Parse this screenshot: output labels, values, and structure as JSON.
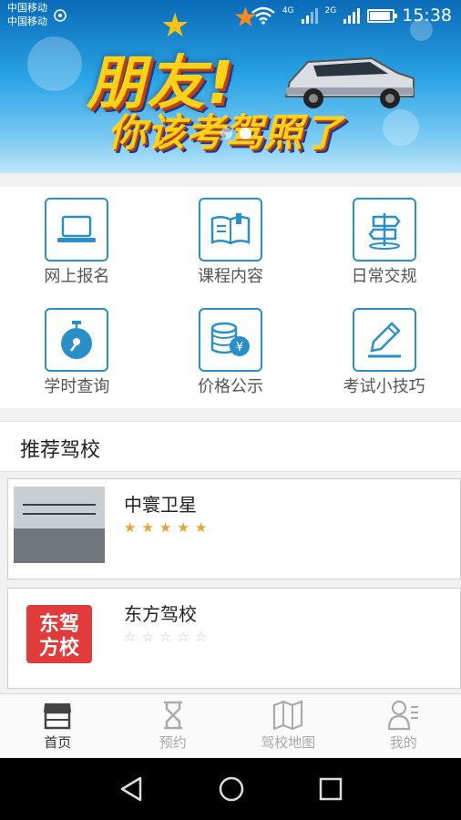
{
  "status_bar": {
    "carrier_1": "中国移动",
    "carrier_2": "中国移动",
    "net_1": "4G",
    "net_2": "2G",
    "battery_level": 0.9,
    "time": "15:38"
  },
  "banner": {
    "headline": "朋友!",
    "subline": "你该考驾照了",
    "slide_count": 2,
    "active_slide": 1
  },
  "categories": [
    {
      "label": "网上报名",
      "icon": "laptop-icon"
    },
    {
      "label": "课程内容",
      "icon": "book-icon"
    },
    {
      "label": "日常交规",
      "icon": "signpost-icon"
    },
    {
      "label": "学时查询",
      "icon": "stopwatch-icon"
    },
    {
      "label": "价格公示",
      "icon": "price-coins-icon"
    },
    {
      "label": "考试小技巧",
      "icon": "pencil-icon"
    }
  ],
  "recommend": {
    "title": "推荐驾校",
    "schools": [
      {
        "name": "中寰卫星",
        "rating": 5,
        "max_rating": 5
      },
      {
        "name": "东方驾校",
        "rating": 0,
        "max_rating": 5,
        "logo_text": [
          "东驾",
          "方校"
        ]
      }
    ]
  },
  "tabs": [
    {
      "label": "首页",
      "icon": "home-shop-icon",
      "active": true
    },
    {
      "label": "预约",
      "icon": "hourglass-icon",
      "active": false
    },
    {
      "label": "驾校地图",
      "icon": "map-icon",
      "active": false
    },
    {
      "label": "我的",
      "icon": "profile-icon",
      "active": false
    }
  ],
  "colors": {
    "accent": "#2a8fc8",
    "star_on": "#f0a030",
    "star_off": "#c8c8c8",
    "tab_active": "#333333",
    "tab_inactive": "#a8a8a8"
  }
}
